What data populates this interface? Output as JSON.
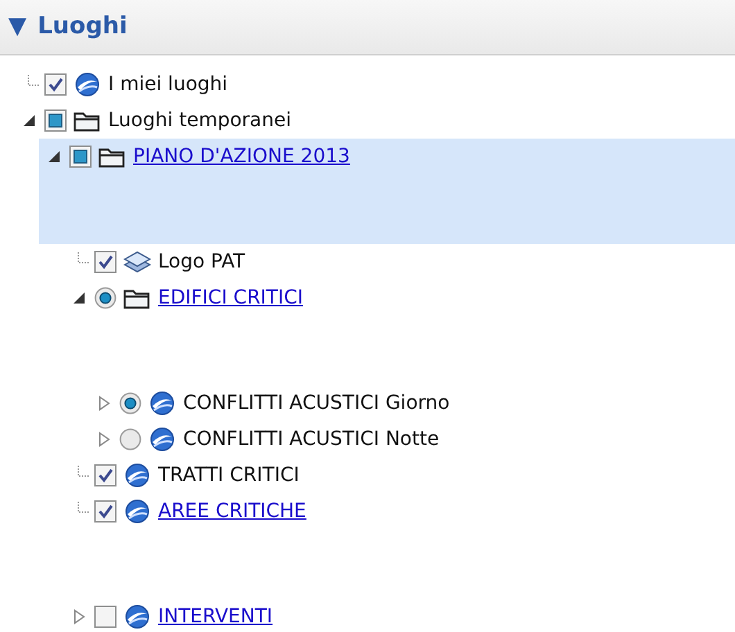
{
  "panel": {
    "toggle": "▼",
    "title": "Luoghi",
    "expanded": true
  },
  "tree": [
    {
      "label": "I miei luoghi",
      "control": {
        "kind": "checkbox",
        "checked": true,
        "mixed": false
      },
      "icon": {
        "kind": "globe"
      },
      "link": false,
      "selected": false
    },
    {
      "label": "Luoghi temporanei",
      "control": {
        "kind": "checkbox",
        "checked": false,
        "mixed": true
      },
      "icon": {
        "kind": "folder"
      },
      "link": false,
      "selected": false,
      "expanded": true,
      "children": [
        {
          "label": "PIANO D'AZIONE 2013",
          "control": {
            "kind": "checkbox",
            "checked": false,
            "mixed": true
          },
          "icon": {
            "kind": "folder"
          },
          "link": true,
          "selected": true,
          "expanded": true,
          "children": [
            {
              "label": "Logo PAT",
              "control": {
                "kind": "checkbox",
                "checked": true,
                "mixed": false
              },
              "icon": {
                "kind": "layers"
              },
              "link": false,
              "selected": false
            },
            {
              "label": "EDIFICI CRITICI",
              "control": {
                "kind": "radio",
                "checked": true
              },
              "icon": {
                "kind": "folder"
              },
              "link": true,
              "selected": false,
              "expanded": true,
              "children": [
                {
                  "label": "CONFLITTI ACUSTICI Giorno",
                  "control": {
                    "kind": "radio",
                    "checked": true
                  },
                  "icon": {
                    "kind": "globe"
                  },
                  "link": false,
                  "selected": false,
                  "expanded": false
                },
                {
                  "label": "CONFLITTI ACUSTICI Notte",
                  "control": {
                    "kind": "radio",
                    "checked": false
                  },
                  "icon": {
                    "kind": "globe"
                  },
                  "link": false,
                  "selected": false,
                  "expanded": false
                }
              ]
            },
            {
              "label": "TRATTI CRITICI",
              "control": {
                "kind": "checkbox",
                "checked": true,
                "mixed": false
              },
              "icon": {
                "kind": "globe"
              },
              "link": false,
              "selected": false
            },
            {
              "label": "AREE CRITICHE",
              "control": {
                "kind": "checkbox",
                "checked": true,
                "mixed": false
              },
              "icon": {
                "kind": "globe"
              },
              "link": true,
              "selected": false
            },
            {
              "label": "INTERVENTI",
              "control": {
                "kind": "checkbox",
                "checked": false,
                "mixed": false
              },
              "icon": {
                "kind": "globe"
              },
              "link": true,
              "selected": false,
              "expanded": false
            }
          ]
        }
      ]
    }
  ]
}
